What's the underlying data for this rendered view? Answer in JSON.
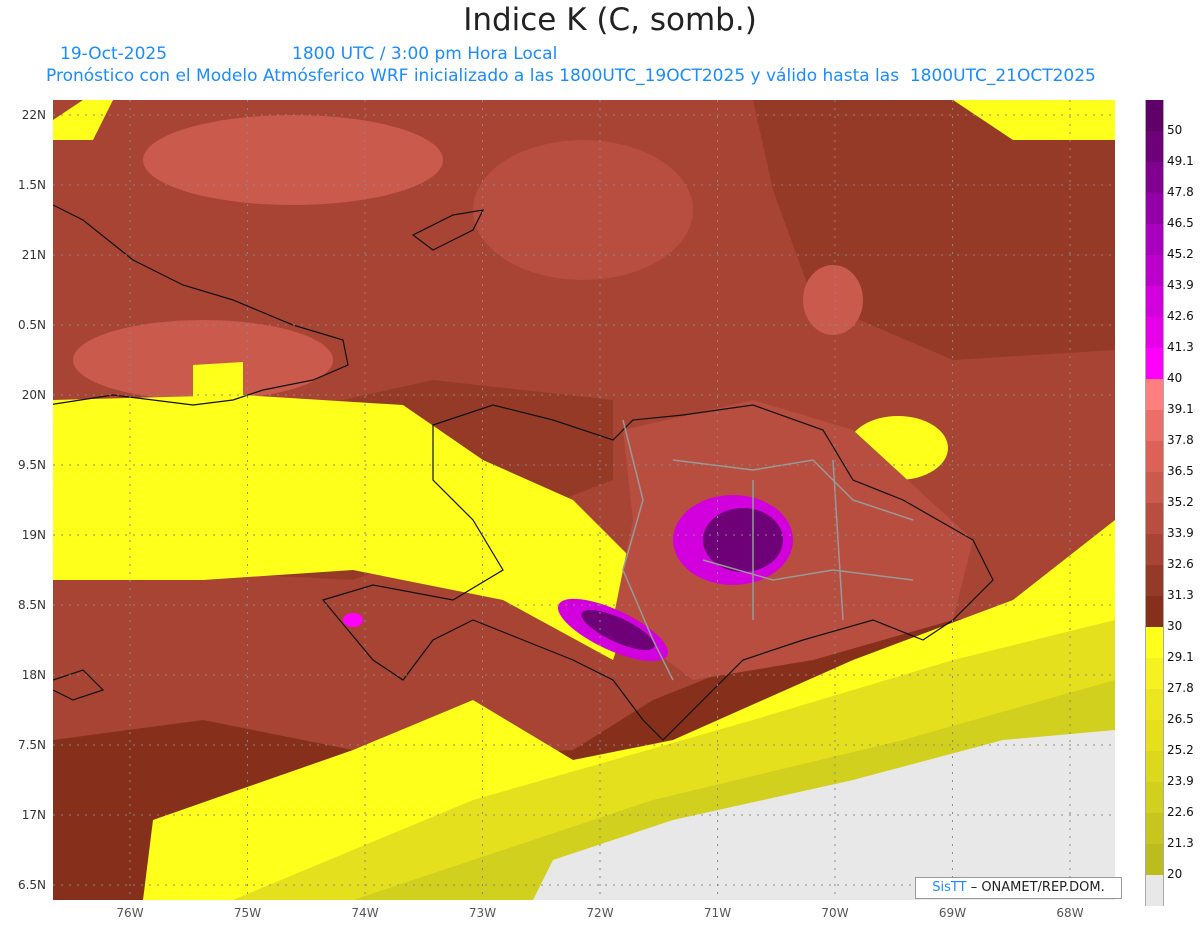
{
  "header": {
    "title": "Indice K (C, somb.)",
    "date": "19-Oct-2025",
    "time": "1800 UTC / 3:00 pm Hora Local",
    "description": "Pronóstico con el Modelo Atmósferico WRF inicializado a las 1800UTC_19OCT2025 y válido hasta las  1800UTC_21OCT2025"
  },
  "axes": {
    "lat_labels": [
      "22N",
      "1.5N",
      "21N",
      "0.5N",
      "20N",
      "9.5N",
      "19N",
      "8.5N",
      "18N",
      "7.5N",
      "17N",
      "6.5N"
    ],
    "lon_labels": [
      "76W",
      "75W",
      "74W",
      "73W",
      "72W",
      "71W",
      "70W",
      "69W",
      "68W"
    ]
  },
  "colorbar": {
    "labels": [
      "50",
      "49.1",
      "47.8",
      "46.5",
      "45.2",
      "43.9",
      "42.6",
      "41.3",
      "40",
      "39.1",
      "37.8",
      "36.5",
      "35.2",
      "33.9",
      "32.6",
      "31.3",
      "30",
      "29.1",
      "27.8",
      "26.5",
      "25.2",
      "23.9",
      "22.6",
      "21.3",
      "20"
    ],
    "colors": [
      "#5e0068",
      "#6e0078",
      "#800090",
      "#9400a8",
      "#a800bc",
      "#bc00cc",
      "#d200dc",
      "#e600ea",
      "#ff00ff",
      "#ff7f7f",
      "#ec6e68",
      "#dc6258",
      "#c95a4c",
      "#b84e40",
      "#a84434",
      "#963a28",
      "#86301c",
      "#ffff1c",
      "#f4f220",
      "#ebe620",
      "#e4e01e",
      "#dcd81e",
      "#d2d01e",
      "#c8c61e",
      "#bcbc1e",
      "#e8e8e8"
    ]
  },
  "credit": {
    "brand": "SisTT",
    "text": " – ONAMET/REP.DOM."
  }
}
